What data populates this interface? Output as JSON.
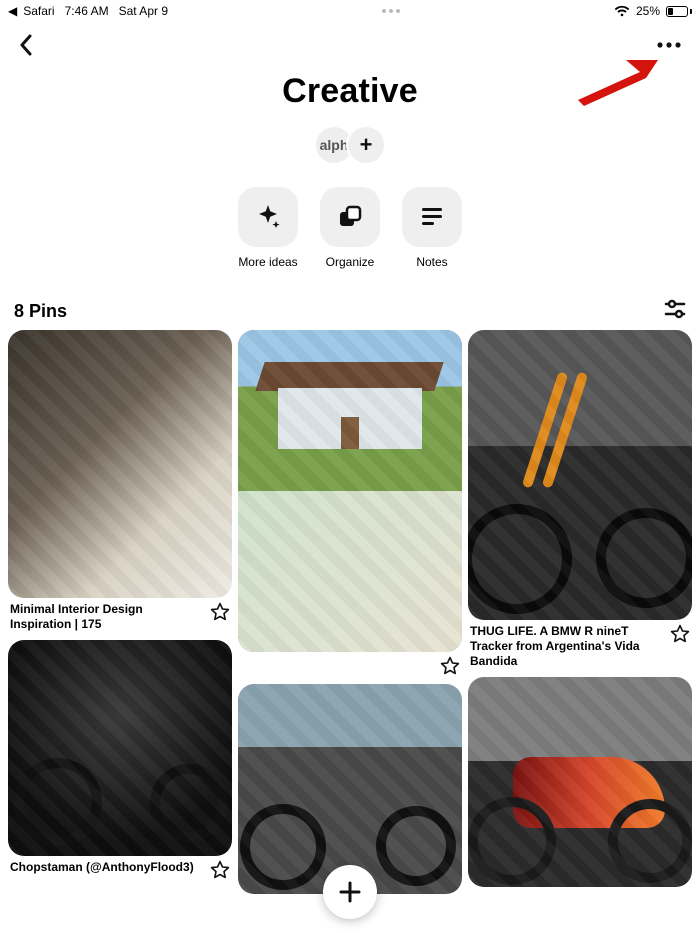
{
  "status": {
    "back_app": "Safari",
    "time": "7:46 AM",
    "date": "Sat Apr 9",
    "battery_pct": "25%"
  },
  "header": {
    "title": "Creative",
    "collaborator_label": "alph",
    "add_label": "+"
  },
  "actions": {
    "more_ideas": "More ideas",
    "organize": "Organize",
    "notes": "Notes"
  },
  "pins": {
    "count_label": "8 Pins"
  },
  "col1": {
    "pin1_caption": "Minimal Interior Design Inspiration | 175",
    "pin2_caption": "Chopstaman (@AnthonyFlood3)"
  },
  "col3": {
    "pin1_caption": "THUG LIFE. A BMW R nineT Tracker from Argentina's Vida Bandida"
  },
  "fab": {
    "plus": "+"
  }
}
